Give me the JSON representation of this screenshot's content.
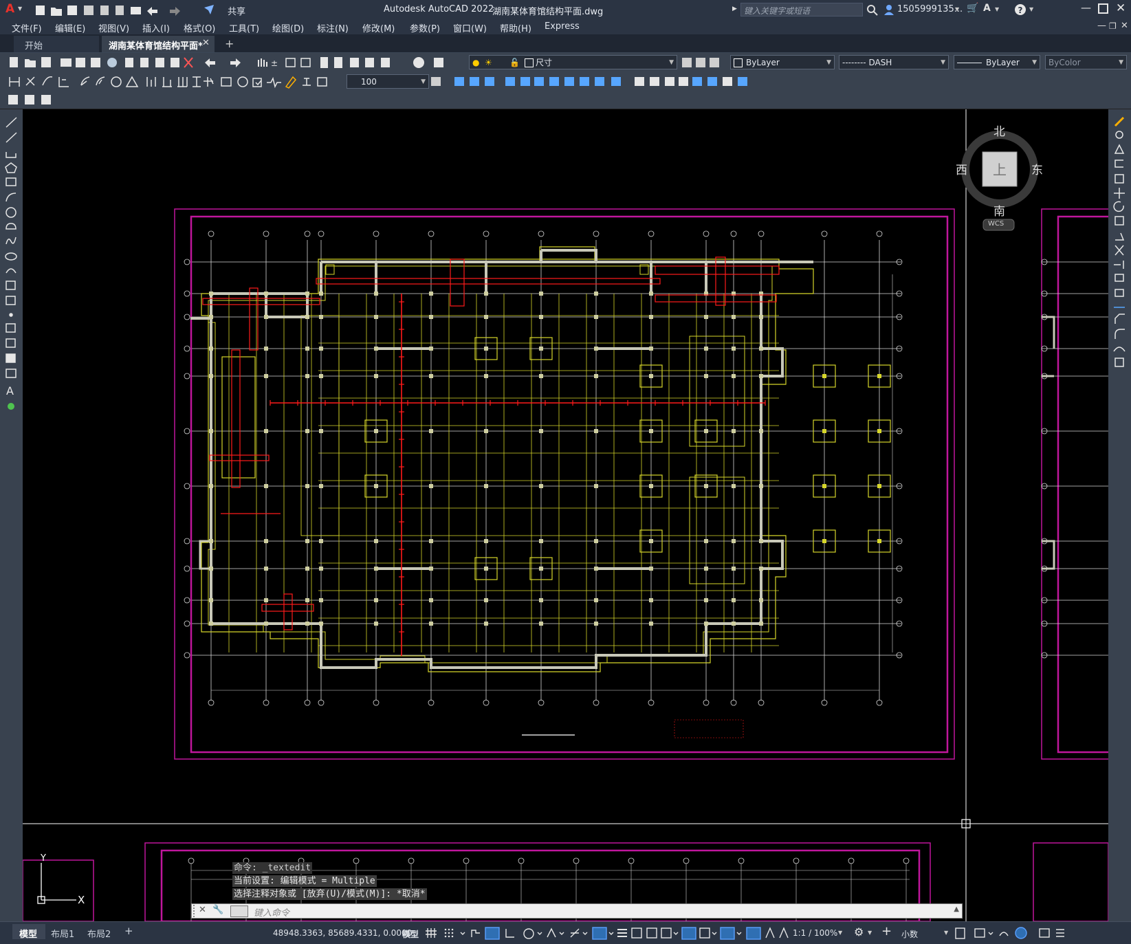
{
  "title_bar": {
    "app": "Autodesk AutoCAD 2022",
    "document": "湖南某体育馆结构平面.dwg",
    "share": "共享",
    "search_placeholder": "键入关键字或短语",
    "user": "1505999135...",
    "app_icon": "A"
  },
  "menu": [
    "文件(F)",
    "编辑(E)",
    "视图(V)",
    "插入(I)",
    "格式(O)",
    "工具(T)",
    "绘图(D)",
    "标注(N)",
    "修改(M)",
    "参数(P)",
    "窗口(W)",
    "帮助(H)",
    "Express"
  ],
  "tabs": {
    "start": "开始",
    "active": "湖南某体育馆结构平面*",
    "add": "+"
  },
  "toolbar": {
    "layer_name": "尺寸",
    "color": "ByLayer",
    "linetype": "-------- DASH",
    "lineweight": "ByLayer",
    "plotstyle": "ByColor",
    "scale_value": "100"
  },
  "viewcube": {
    "north": "北",
    "south": "南",
    "east": "东",
    "west": "西",
    "top": "上",
    "wcs": "WCS"
  },
  "ucs": {
    "y": "Y",
    "x": "X"
  },
  "command": {
    "history": [
      "命令: _textedit",
      "当前设置: 编辑模式 = Multiple",
      "选择注释对象或 [放弃(U)/模式(M)]: *取消*"
    ],
    "placeholder": "键入命令"
  },
  "layout_tabs": [
    "模型",
    "布局1",
    "布局2",
    "+"
  ],
  "status": {
    "coordinates": "48948.3363, 85689.4331, 0.0000",
    "space": "模型",
    "scale": "1:1 / 100%",
    "units": "小数"
  },
  "colors": {
    "chrome": "#2b3443",
    "toolbar": "#39424f",
    "canvas": "#000000",
    "frame": "#c0169c",
    "structure": "#d6d62a",
    "walls": "#c8c8b8",
    "section": "#ff1a1a",
    "grid": "#d8d8d8"
  }
}
